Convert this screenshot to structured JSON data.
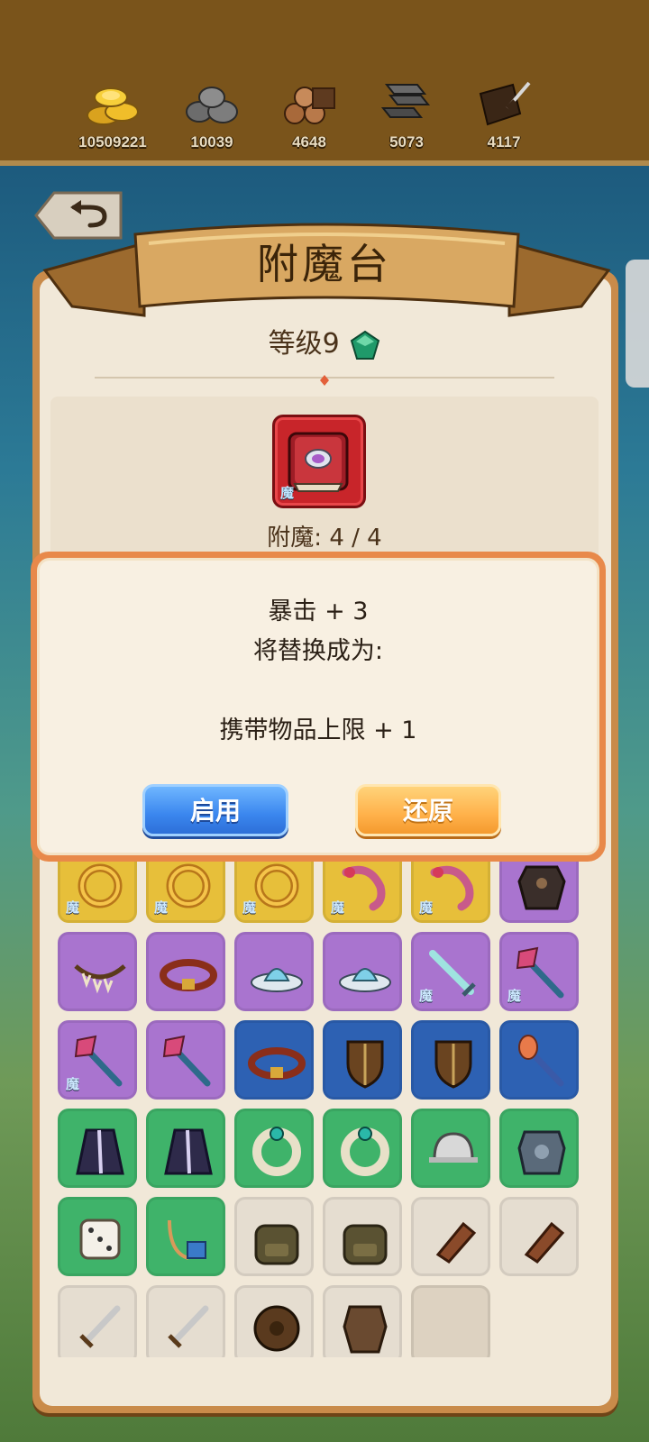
{
  "resources": [
    {
      "name": "gold-coins",
      "value": "10509221"
    },
    {
      "name": "stone",
      "value": "10039"
    },
    {
      "name": "wood",
      "value": "4648"
    },
    {
      "name": "iron",
      "value": "5073"
    },
    {
      "name": "leather",
      "value": "4117"
    }
  ],
  "title": "附魔台",
  "level": "等级9",
  "selected_item": {
    "icon": "red-spellbook-icon",
    "badge": "魔"
  },
  "enchant_count": "附魔: 4 / 4",
  "dialog": {
    "line1": "暴击 + 3",
    "line2": "将替换成为:",
    "line3": "携带物品上限 + 1",
    "apply_label": "启用",
    "revert_label": "还原"
  },
  "inventory": [
    {
      "rarity": "yellow",
      "icon": "gold-ring-icon",
      "badge": "魔"
    },
    {
      "rarity": "yellow",
      "icon": "gold-ring-icon",
      "badge": "魔"
    },
    {
      "rarity": "yellow",
      "icon": "gold-ring-icon",
      "badge": "魔"
    },
    {
      "rarity": "yellow",
      "icon": "horn-icon",
      "badge": "魔"
    },
    {
      "rarity": "yellow",
      "icon": "horn-icon",
      "badge": "魔"
    },
    {
      "rarity": "purple",
      "icon": "dark-armor-icon",
      "badge": ""
    },
    {
      "rarity": "purple",
      "icon": "tooth-necklace-icon",
      "badge": ""
    },
    {
      "rarity": "purple",
      "icon": "belt-icon",
      "badge": ""
    },
    {
      "rarity": "purple",
      "icon": "crystal-hat-icon",
      "badge": ""
    },
    {
      "rarity": "purple",
      "icon": "crystal-hat-icon",
      "badge": ""
    },
    {
      "rarity": "purple",
      "icon": "ice-sword-icon",
      "badge": "魔"
    },
    {
      "rarity": "purple",
      "icon": "crystal-staff-icon",
      "badge": "魔"
    },
    {
      "rarity": "purple",
      "icon": "crystal-staff-icon",
      "badge": "魔"
    },
    {
      "rarity": "purple",
      "icon": "crystal-staff-icon",
      "badge": ""
    },
    {
      "rarity": "blue",
      "icon": "belt-icon",
      "badge": ""
    },
    {
      "rarity": "blue",
      "icon": "wooden-shield-icon",
      "badge": ""
    },
    {
      "rarity": "blue",
      "icon": "wooden-shield-icon",
      "badge": ""
    },
    {
      "rarity": "blue",
      "icon": "fire-staff-icon",
      "badge": ""
    },
    {
      "rarity": "green",
      "icon": "cloak-icon",
      "badge": ""
    },
    {
      "rarity": "green",
      "icon": "cloak-icon",
      "badge": ""
    },
    {
      "rarity": "green",
      "icon": "bracelet-icon",
      "badge": ""
    },
    {
      "rarity": "green",
      "icon": "bracelet-icon",
      "badge": ""
    },
    {
      "rarity": "green",
      "icon": "helmet-icon",
      "badge": ""
    },
    {
      "rarity": "green",
      "icon": "chain-armor-icon",
      "badge": ""
    },
    {
      "rarity": "green",
      "icon": "dice-icon",
      "badge": ""
    },
    {
      "rarity": "green",
      "icon": "amulet-icon",
      "badge": ""
    },
    {
      "rarity": "white",
      "icon": "backpack-icon",
      "badge": ""
    },
    {
      "rarity": "white",
      "icon": "backpack-icon",
      "badge": ""
    },
    {
      "rarity": "white",
      "icon": "leather-glove-icon",
      "badge": ""
    },
    {
      "rarity": "white",
      "icon": "leather-glove-icon",
      "badge": ""
    },
    {
      "rarity": "white",
      "icon": "short-sword-icon",
      "badge": ""
    },
    {
      "rarity": "white",
      "icon": "short-sword-icon",
      "badge": ""
    },
    {
      "rarity": "white",
      "icon": "round-shield-icon",
      "badge": ""
    },
    {
      "rarity": "white",
      "icon": "leather-armor-icon",
      "badge": ""
    },
    {
      "rarity": "empty",
      "icon": "",
      "badge": ""
    }
  ]
}
